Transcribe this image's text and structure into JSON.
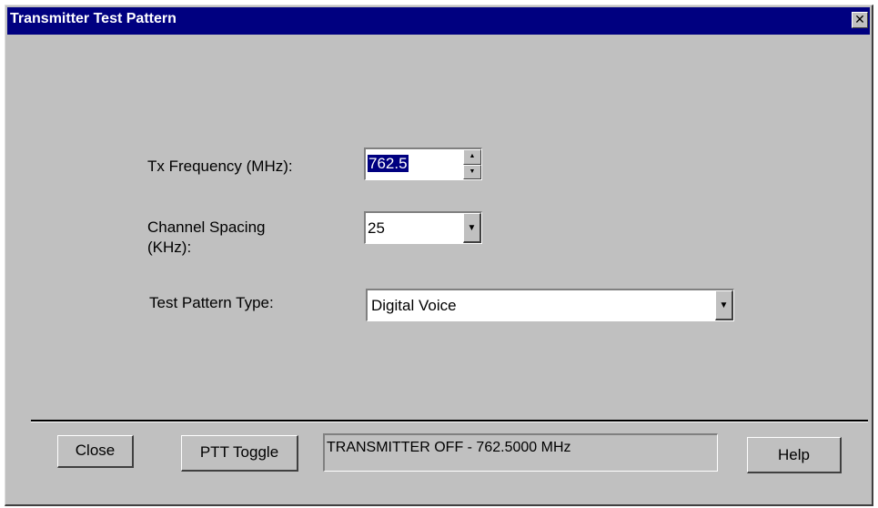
{
  "window": {
    "title": "Transmitter Test Pattern",
    "close_glyph": "✕",
    "titlebar_color": "#000080",
    "face_color": "#c0c0c0"
  },
  "form": {
    "tx_frequency": {
      "label": "Tx Frequency (MHz):",
      "value": "762.5",
      "spin_up": "▲",
      "spin_down": "▼"
    },
    "channel_spacing": {
      "label_line1": "Channel Spacing",
      "label_line2": "(KHz):",
      "value": "25",
      "dropdown_glyph": "▼"
    },
    "test_pattern_type": {
      "label": "Test  Pattern Type:",
      "value": "Digital Voice",
      "dropdown_glyph": "▼"
    }
  },
  "footer": {
    "close_label": "Close",
    "ptt_label": "PTT Toggle",
    "status_text": "TRANSMITTER OFF - 762.5000 MHz",
    "help_label": "Help"
  }
}
